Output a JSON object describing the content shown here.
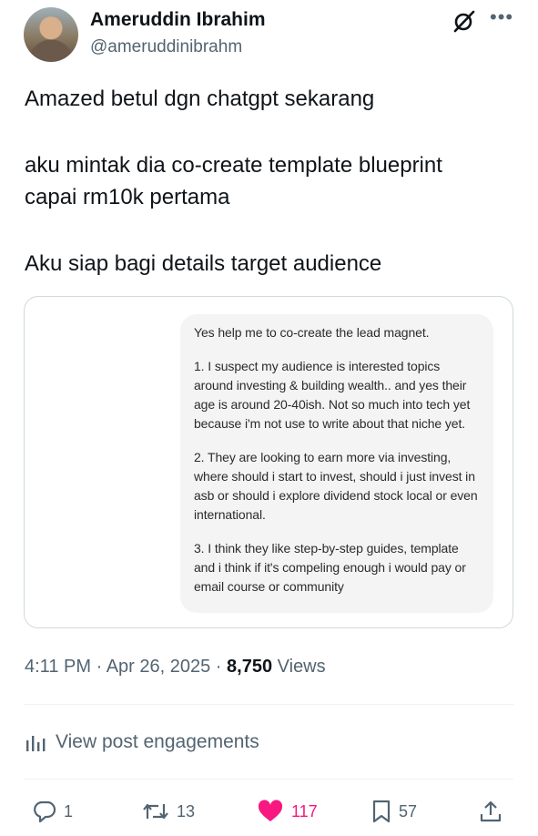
{
  "author": {
    "name": "Ameruddin Ibrahim",
    "handle": "@ameruddinibrahm"
  },
  "tweet": {
    "lines": [
      "Amazed betul dgn chatgpt sekarang",
      "aku mintak dia co-create template blueprint",
      "capai rm10k pertama",
      "Aku siap bagi details target audience"
    ]
  },
  "image": {
    "paragraphs": [
      "Yes help me to co-create the lead magnet.",
      "1. I suspect my audience is interested topics around investing & building wealth.. and yes their age is around 20-40ish. Not so much into tech yet because i'm not use to write about that niche yet.",
      "2. They are looking to earn more via investing, where should i start to invest, should i just invest in asb or should i explore dividend stock local or even international.",
      "3. I think they like step-by-step guides, template and i think if it's compeling enough i would pay or email course or community"
    ]
  },
  "meta": {
    "time": "4:11 PM",
    "separator": "·",
    "date": "Apr 26, 2025",
    "views_count": "8,750",
    "views_label": "Views"
  },
  "engagements_label": "View post engagements",
  "actions": {
    "replies": "1",
    "reposts": "13",
    "likes": "117",
    "bookmarks": "57"
  },
  "colors": {
    "like": "#f91880",
    "muted": "#536471",
    "text": "#0f1419"
  }
}
